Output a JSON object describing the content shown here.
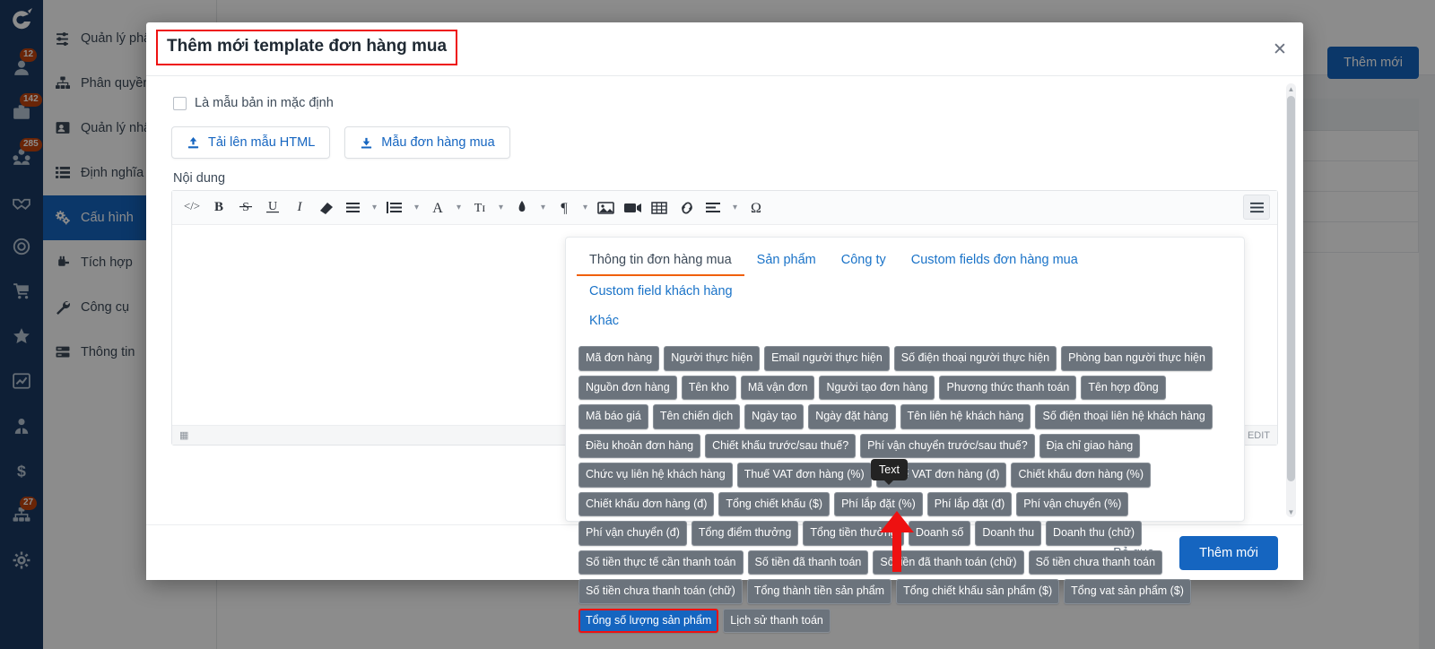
{
  "app": {
    "rail": {
      "logo_icon": "brand-logo-icon",
      "items": [
        {
          "icon": "user-icon",
          "badge": "12"
        },
        {
          "icon": "briefcase-icon",
          "badge": "142"
        },
        {
          "icon": "people-group-icon",
          "badge": "285"
        },
        {
          "icon": "handshake-icon",
          "badge": ""
        },
        {
          "icon": "target-icon",
          "badge": ""
        },
        {
          "icon": "cart-icon",
          "badge": ""
        },
        {
          "icon": "star-icon",
          "badge": ""
        },
        {
          "icon": "chart-line-icon",
          "badge": ""
        },
        {
          "icon": "agent-icon",
          "badge": ""
        },
        {
          "icon": "dollar-icon",
          "badge": ""
        },
        {
          "icon": "org-chart-icon",
          "badge": "27"
        },
        {
          "icon": "gear-icon",
          "badge": ""
        }
      ]
    },
    "sidebar": {
      "items": [
        {
          "label": "Quản lý phân quyền",
          "icon": "sliders-icon",
          "active": false
        },
        {
          "label": "Phân quyền",
          "icon": "hierarchy-icon",
          "active": false
        },
        {
          "label": "Quản lý nhân viên",
          "icon": "contact-card-icon",
          "active": false
        },
        {
          "label": "Định nghĩa",
          "icon": "list-icon",
          "active": false
        },
        {
          "label": "Cấu hình",
          "icon": "cogs-icon",
          "active": true
        },
        {
          "label": "Tích hợp",
          "icon": "plug-icon",
          "active": false
        },
        {
          "label": "Công cụ",
          "icon": "wrench-icon",
          "active": false
        },
        {
          "label": "Thông tin",
          "icon": "server-icon",
          "active": false
        }
      ]
    },
    "content": {
      "add_button_label": "Thêm mới"
    }
  },
  "modal": {
    "title": "Thêm mới template đơn hàng mua",
    "close_icon": "close-icon",
    "default_print_checkbox": {
      "label": "Là mẫu bản in mặc định",
      "checked": false
    },
    "upload_button": {
      "label": "Tải lên mẫu HTML",
      "icon": "upload-icon"
    },
    "sample_button": {
      "label": "Mẫu đơn hàng mua",
      "icon": "download-icon"
    },
    "content_label": "Nội dung",
    "editor": {
      "toolbar": [
        {
          "icon": "code-icon",
          "glyph": "</>",
          "caret": false
        },
        {
          "icon": "bold-icon",
          "glyph": "B",
          "caret": false
        },
        {
          "icon": "strikethrough-icon",
          "glyph": "S",
          "caret": false
        },
        {
          "icon": "underline-icon",
          "glyph": "U",
          "caret": false
        },
        {
          "icon": "italic-icon",
          "glyph": "I",
          "caret": false
        },
        {
          "icon": "eraser-icon",
          "glyph": "▰",
          "caret": false
        },
        {
          "icon": "unordered-list-icon",
          "glyph": "☰",
          "caret": true
        },
        {
          "icon": "ordered-list-icon",
          "glyph": "☷",
          "caret": true
        },
        {
          "icon": "font-color-icon",
          "glyph": "A",
          "caret": true
        },
        {
          "icon": "font-size-icon",
          "glyph": "Tɪ",
          "caret": true
        },
        {
          "icon": "highlight-color-icon",
          "glyph": "◆",
          "caret": true
        },
        {
          "icon": "paragraph-icon",
          "glyph": "¶",
          "caret": true
        },
        {
          "icon": "image-icon",
          "glyph": "ὛC",
          "caret": false
        },
        {
          "icon": "video-icon",
          "glyph": "▶",
          "caret": false
        },
        {
          "icon": "table-icon",
          "glyph": "⊞",
          "caret": false
        },
        {
          "icon": "link-icon",
          "glyph": "ὑ7",
          "caret": false
        },
        {
          "icon": "align-icon",
          "glyph": "≡",
          "caret": true
        },
        {
          "icon": "special-char-icon",
          "glyph": "Ω",
          "caret": false
        }
      ],
      "toggle_panel_icon": "list-toggle-icon",
      "status_left_icon": "resize-handle-icon",
      "status_right_label": "EDIT"
    },
    "footer": {
      "cancel_label": "Bỏ qua",
      "submit_label": "Thêm mới"
    }
  },
  "picker": {
    "tabs": [
      {
        "label": "Thông tin đơn hàng mua",
        "active": true
      },
      {
        "label": "Sản phẩm",
        "active": false
      },
      {
        "label": "Công ty",
        "active": false
      },
      {
        "label": "Custom fields đơn hàng mua",
        "active": false
      },
      {
        "label": "Custom field khách hàng",
        "active": false
      }
    ],
    "tabs_row2": [
      {
        "label": "Khác",
        "active": false
      }
    ],
    "selected_tag": "Tổng số lượng sản phẩm",
    "tags": [
      "Mã đơn hàng",
      "Người thực hiện",
      "Email người thực hiện",
      "Số điện thoại người thực hiện",
      "Phòng ban người thực hiện",
      "Nguồn đơn hàng",
      "Tên kho",
      "Mã vận đơn",
      "Người tạo đơn hàng",
      "Phương thức thanh toán",
      "Tên hợp đồng",
      "Mã báo giá",
      "Tên chiến dịch",
      "Ngày tạo",
      "Ngày đặt hàng",
      "Tên liên hệ khách hàng",
      "Số điện thoại liên hệ khách hàng",
      "Điều khoản đơn hàng",
      "Chiết khấu trước/sau thuế?",
      "Phí vận chuyển trước/sau thuế?",
      "Địa chỉ giao hàng",
      "Chức vụ liên hệ khách hàng",
      "Thuế VAT đơn hàng (%)",
      "Thuế VAT đơn hàng (đ)",
      "Chiết khấu đơn hàng (%)",
      "Chiết khấu đơn hàng (đ)",
      "Tổng chiết khấu ($)",
      "Phí lắp đặt (%)",
      "Phí lắp đặt (đ)",
      "Phí vận chuyển (%)",
      "Phí vận chuyển (đ)",
      "Tổng điểm thưởng",
      "Tổng tiền thưởng",
      "Doanh số",
      "Doanh thu",
      "Doanh thu (chữ)",
      "Số tiền thực tế cần thanh toán",
      "Số tiền đã thanh toán",
      "Số tiền đã thanh toán (chữ)",
      "Số tiền chưa thanh toán",
      "Số tiền chưa thanh toán (chữ)",
      "Tổng thành tiền sản phẩm",
      "Tổng chiết khấu sản phẩm ($)",
      "Tổng vat sản phẩm ($)",
      "Tổng số lượng sản phẩm",
      "Lịch sử thanh toán"
    ]
  },
  "tooltip": {
    "text": "Text"
  },
  "colors": {
    "primary": "#1565c0",
    "annotation_red": "#ee1111",
    "tab_active_underline": "#f0600a",
    "tag_bg": "#6b737c",
    "rail_bg": "#1b3a63",
    "badge_bg": "#c1440e"
  }
}
